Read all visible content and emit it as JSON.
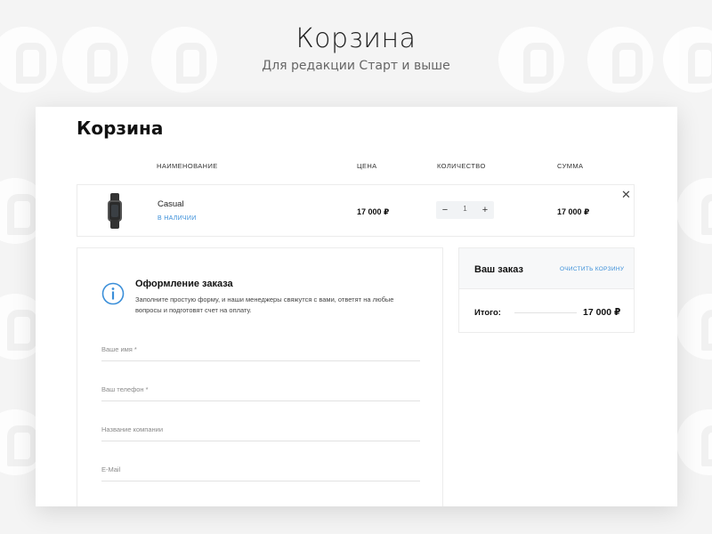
{
  "header": {
    "title": "Корзина",
    "subtitle": "Для редакции Старт и выше"
  },
  "cart": {
    "heading": "Корзина",
    "columns": {
      "name": "НАИМЕНОВАНИЕ",
      "price": "ЦЕНА",
      "quantity": "КОЛИЧЕСТВО",
      "sum": "СУММА"
    },
    "item": {
      "name": "Casual",
      "stock": "В НАЛИЧИИ",
      "price": "17 000 ₽",
      "quantity": "1",
      "minus": "−",
      "plus": "+",
      "sum": "17 000 ₽",
      "remove": "✕"
    }
  },
  "form": {
    "title": "Оформление заказа",
    "description": "Заполните простую форму, и наши менеджеры свяжутся с вами, ответят на любые вопросы и подготовят счет на оплату.",
    "fields": [
      {
        "placeholder": "Ваше имя *"
      },
      {
        "placeholder": "Ваш телефон *"
      },
      {
        "placeholder": "Название компании"
      },
      {
        "placeholder": "E-Mail"
      }
    ]
  },
  "order": {
    "title": "Ваш заказ",
    "clear": "ОЧИСТИТЬ КОРЗИНУ",
    "total_label": "Итого:",
    "total_value": "17 000 ₽"
  },
  "colors": {
    "accent": "#3b8fd9",
    "text": "#111111",
    "background": "#f4f4f4"
  },
  "icons": [
    "logo-watermark-icon",
    "watch-product-image",
    "info-icon",
    "close-icon"
  ]
}
